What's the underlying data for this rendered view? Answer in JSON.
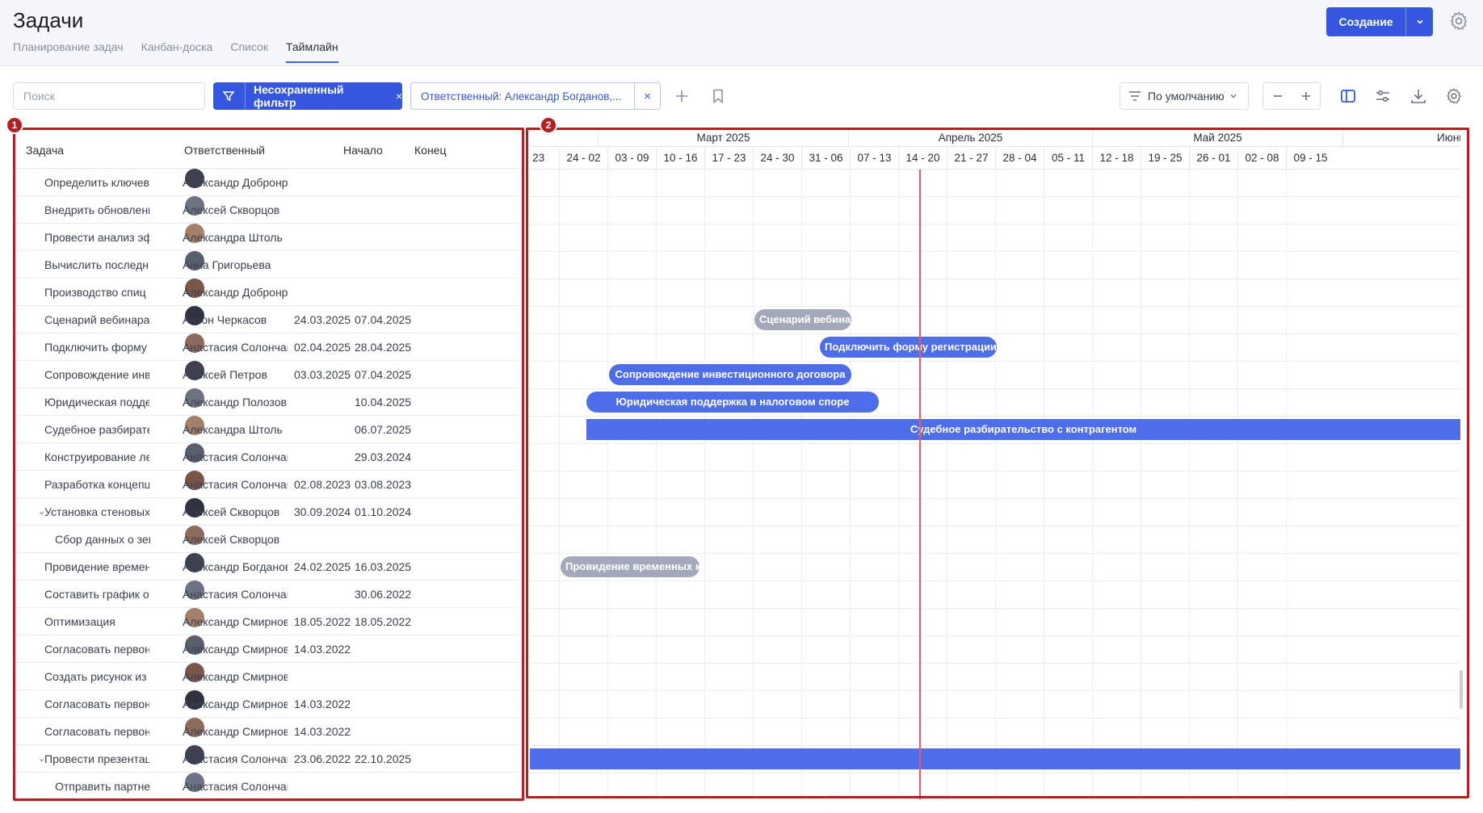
{
  "page": {
    "title": "Задачи",
    "tabs": [
      "Планирование задач",
      "Канбан-доска",
      "Список",
      "Таймлайн"
    ],
    "active_tab": "Таймлайн",
    "create_label": "Создание"
  },
  "toolbar": {
    "search_placeholder": "Поиск",
    "filter_label": "Несохраненный фильтр",
    "filter_clear": "×",
    "chip_label": "Ответственный: Александр Богданов,...",
    "chip_clear": "×",
    "sort_label": "По умолчанию"
  },
  "annotations": [
    "1",
    "2"
  ],
  "colors": {
    "accent": "#3557e0",
    "bar_blue": "#4d6ee8",
    "bar_grey": "#a3a8bb",
    "today_line": "#e65a6e",
    "annotation": "#b41f1f"
  },
  "table": {
    "headers": {
      "task": "Задача",
      "responsible": "Ответственный",
      "start": "Начало",
      "end": "Конец"
    },
    "rows": [
      {
        "task": "Определить ключевы...",
        "resp": "Александр Добронравов",
        "start": "",
        "end": "",
        "indent": 0,
        "expand": false
      },
      {
        "task": "Внедрить обновления...",
        "resp": "Алексей Скворцов",
        "start": "",
        "end": "",
        "indent": 0,
        "expand": false
      },
      {
        "task": "Провести анализ эфф...",
        "resp": "Александра Штоль",
        "start": "",
        "end": "",
        "indent": 0,
        "expand": false
      },
      {
        "task": "Вычислить последни...",
        "resp": "Анна Григорьева",
        "start": "",
        "end": "",
        "indent": 0,
        "expand": false
      },
      {
        "task": "Производство спиц",
        "resp": "Александр Добронравов",
        "start": "",
        "end": "",
        "indent": 0,
        "expand": false
      },
      {
        "task": "Сценарий вебинара",
        "resp": "Антон Черкасов",
        "start": "24.03.2025",
        "end": "07.04.2025",
        "indent": 0,
        "expand": false
      },
      {
        "task": "Подключить форму р...",
        "resp": "Анастасия Солончак",
        "start": "02.04.2025",
        "end": "28.04.2025",
        "indent": 0,
        "expand": false
      },
      {
        "task": "Сопровождение инве...",
        "resp": "Алексей Петров",
        "start": "03.03.2025",
        "end": "07.04.2025",
        "indent": 0,
        "expand": false
      },
      {
        "task": "Юридическая поддер...",
        "resp": "Александр Полозов",
        "start": "",
        "end": "10.04.2025",
        "indent": 0,
        "expand": false
      },
      {
        "task": "Судебное разбирател...",
        "resp": "Александра Штоль",
        "start": "",
        "end": "06.07.2025",
        "indent": 0,
        "expand": false
      },
      {
        "task": "Конструирование лек...",
        "resp": "Анастасия Солончак",
        "start": "",
        "end": "29.03.2024",
        "indent": 0,
        "expand": false
      },
      {
        "task": "Разработка концепци...",
        "resp": "Анастасия Солончак",
        "start": "02.08.2023",
        "end": "03.08.2023",
        "indent": 0,
        "expand": false
      },
      {
        "task": "Установка стеновых к...",
        "resp": "Алексей Скворцов",
        "start": "30.09.2024",
        "end": "01.10.2024",
        "indent": 0,
        "expand": true
      },
      {
        "task": "Сбор данных о зем...",
        "resp": "Алексей Скворцов",
        "start": "",
        "end": "",
        "indent": 1,
        "expand": false
      },
      {
        "task": "Провидение временн...",
        "resp": "Александр Богданов",
        "start": "24.02.2025",
        "end": "16.03.2025",
        "indent": 0,
        "expand": false
      },
      {
        "task": "Составить график отп...",
        "resp": "Анастасия Солончак",
        "start": "",
        "end": "30.06.2022",
        "indent": 0,
        "expand": false
      },
      {
        "task": "Оптимизация",
        "resp": "Александр Смирнов",
        "start": "18.05.2022",
        "end": "18.05.2022",
        "indent": 0,
        "expand": false
      },
      {
        "task": "Согласовать первона...",
        "resp": "Александр Смирнов",
        "start": "14.03.2022",
        "end": "",
        "indent": 0,
        "expand": false
      },
      {
        "task": "Создать рисунок из п...",
        "resp": "Александр Смирнов",
        "start": "",
        "end": "",
        "indent": 0,
        "expand": false
      },
      {
        "task": "Согласовать первона...",
        "resp": "Александр Смирнов",
        "start": "14.03.2022",
        "end": "",
        "indent": 0,
        "expand": false
      },
      {
        "task": "Согласовать первона...",
        "resp": "Александр Смирнов",
        "start": "14.03.2022",
        "end": "",
        "indent": 0,
        "expand": false
      },
      {
        "task": "Провести презентаци...",
        "resp": "Анастасия Солончак",
        "start": "23.06.2022",
        "end": "22.10.2025",
        "indent": 0,
        "expand": true
      },
      {
        "task": "Отправить партнер...",
        "resp": "Анастасия Солончак",
        "start": "",
        "end": "",
        "indent": 1,
        "expand": false
      }
    ]
  },
  "timeline": {
    "months": [
      "Март 2025",
      "Апрель 2025",
      "Май 2025",
      "Июнь"
    ],
    "weeks": [
      "- 23",
      "24 - 02",
      "03 - 09",
      "10 - 16",
      "17 - 23",
      "24 - 30",
      "31 - 06",
      "07 - 13",
      "14 - 20",
      "21 - 27",
      "28 - 04",
      "05 - 11",
      "12 - 18",
      "19 - 25",
      "26 - 01",
      "02 - 08",
      "09 - 15"
    ],
    "bars": [
      {
        "row": 5,
        "label": "Сценарий вебинара",
        "color": "grey"
      },
      {
        "row": 6,
        "label": "Подключить форму регистрации",
        "color": "blue"
      },
      {
        "row": 7,
        "label": "Сопровождение инвестиционного договора",
        "color": "blue"
      },
      {
        "row": 8,
        "label": "Юридическая поддержка в налоговом споре",
        "color": "blue"
      },
      {
        "row": 9,
        "label": "Судебное разбирательство с контрагентом",
        "color": "blue"
      },
      {
        "row": 14,
        "label": "Провидение временных ком...",
        "color": "grey"
      },
      {
        "row": 21,
        "label": "",
        "color": "blue"
      }
    ]
  }
}
